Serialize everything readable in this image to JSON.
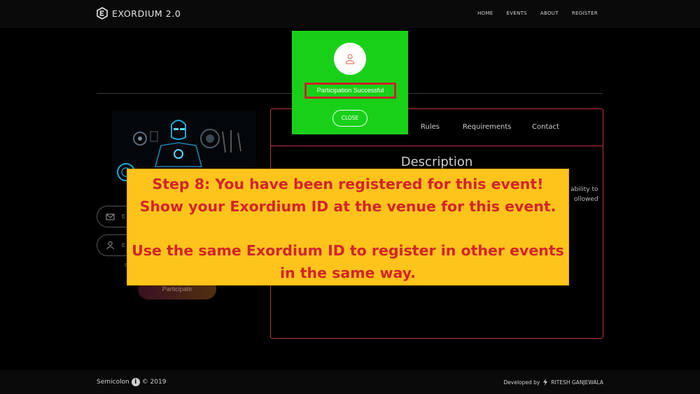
{
  "brand": {
    "name": "EXORDIUM 2.0"
  },
  "nav": {
    "items": [
      "HOME",
      "EVENTS",
      "ABOUT",
      "REGISTER"
    ]
  },
  "form": {
    "email_placeholder_fragment": "E",
    "id_placeholder_fragment": "E",
    "note_fragment": "E",
    "participate_label": "Participate"
  },
  "panel": {
    "tabs": [
      "Rules",
      "Requirements",
      "Contact"
    ],
    "description_title": "Description",
    "text_fragments": [
      "ability to",
      "ollowed"
    ]
  },
  "modal": {
    "message": "Participation Successful",
    "close_label": "CLOSE",
    "bg_color": "#19d019",
    "highlight_color": "#c8242a"
  },
  "instruction": {
    "lines": [
      "Step 8: You have been registered for this event!",
      "Show your Exordium ID at the venue for this event.",
      "",
      "Use the same Exordium ID to register in other events",
      "in the same way."
    ],
    "bg_color": "#fdc41c",
    "text_color": "#d4242a"
  },
  "footer": {
    "left": "Semicolon",
    "year": "© 2019",
    "developed_by": "Developed by",
    "developer": "RITESH GANJEWALA"
  },
  "icons": [
    "exordium-logo-icon",
    "mail-icon",
    "user-icon",
    "avatar-icon",
    "semicolon-icon",
    "bolt-icon"
  ]
}
